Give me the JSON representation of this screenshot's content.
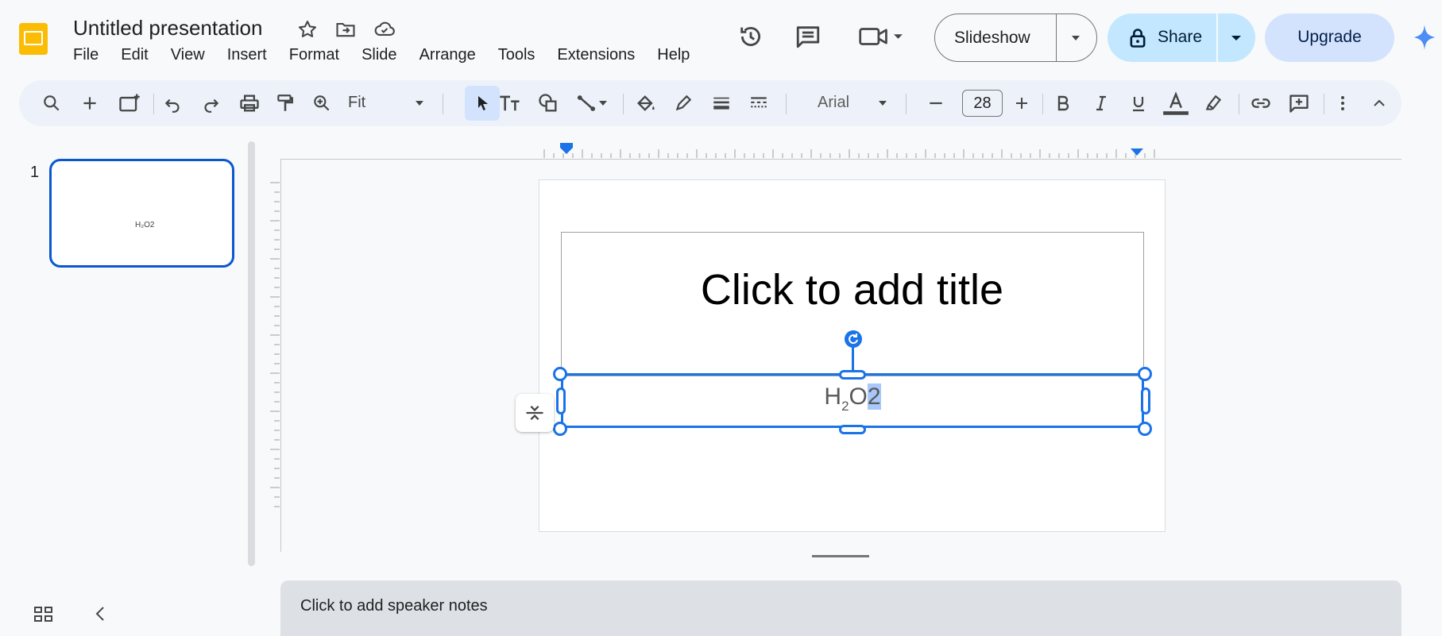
{
  "header": {
    "doc_title": "Untitled presentation",
    "menu": [
      "File",
      "Edit",
      "View",
      "Insert",
      "Format",
      "Slide",
      "Arrange",
      "Tools",
      "Extensions",
      "Help"
    ],
    "slideshow_label": "Slideshow",
    "share_label": "Share",
    "upgrade_label": "Upgrade"
  },
  "toolbar": {
    "zoom": "Fit",
    "font": "Arial",
    "font_size": "28"
  },
  "filmstrip": {
    "slide_number": "1",
    "thumb_text": "H₂O2"
  },
  "slide": {
    "title_placeholder": "Click to add title",
    "subtitle": {
      "main": "H",
      "sub": "2",
      "mid": "O",
      "selected": "2"
    }
  },
  "notes": {
    "placeholder": "Click to add speaker notes"
  },
  "colors": {
    "accent": "#1a73e8",
    "share_bg": "#c2e7ff",
    "upgrade_bg": "#d3e3fd",
    "toolbar_bg": "#edf2fa"
  }
}
